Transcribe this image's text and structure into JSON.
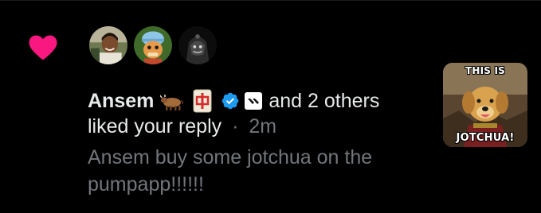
{
  "notification": {
    "type_icon": "heart-icon",
    "heart_color": "#f91880",
    "avatars": [
      {
        "icon": "avatar-man-smiling"
      },
      {
        "icon": "avatar-cartoon-character-cap"
      },
      {
        "icon": "avatar-dark-hooded-figure"
      }
    ],
    "user_name": "Ansem",
    "name_emojis": [
      "ox-emoji",
      "mahjong-red-dragon-emoji"
    ],
    "badges": {
      "verified_color": "#1d9bf0",
      "verified_icon": "verified-badge-icon",
      "affiliate_icon": "affiliate-logo-icon"
    },
    "others_text": "and 2 others",
    "action_text": "liked your reply",
    "separator": "·",
    "time": "2m",
    "reply_snippet": "Ansem buy some jotchua on the pumpapp!!!!!!",
    "thumbnail": {
      "top_text": "THIS IS",
      "bottom_text": "JOTCHUA!"
    }
  },
  "colors": {
    "background": "#000000",
    "primary_text": "#e7e9ea",
    "secondary_text": "#71767b"
  }
}
